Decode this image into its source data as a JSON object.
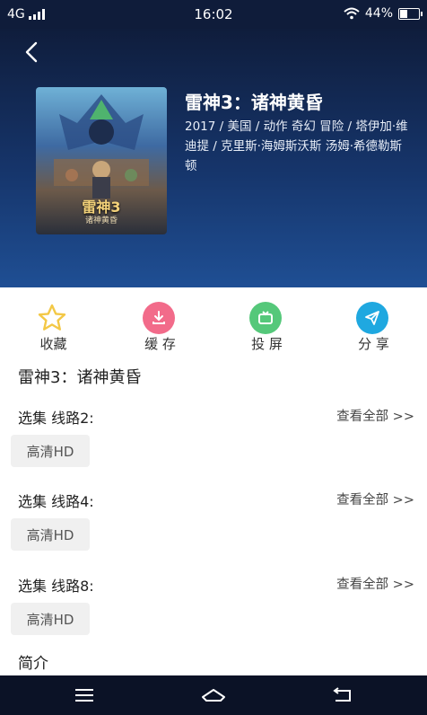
{
  "status": {
    "network": "4G",
    "time": "16:02",
    "battery_text": "44%",
    "battery_level": 0.44
  },
  "movie": {
    "title": "雷神3：诸神黄昏",
    "meta": "2017 / 美国 / 动作 奇幻 冒险 / 塔伊加·维迪提 / 克里斯·海姆斯沃斯 汤姆·希德勒斯顿",
    "poster_title": "雷神3",
    "poster_subtitle": "诸神黄昏"
  },
  "actions": [
    {
      "label": "收藏",
      "icon": "star-icon",
      "color": "#f3c846"
    },
    {
      "label": "缓 存",
      "icon": "download-icon",
      "color": "#f26b8a"
    },
    {
      "label": "投 屏",
      "icon": "tv-icon",
      "color": "#55c87a"
    },
    {
      "label": "分 享",
      "icon": "send-icon",
      "color": "#1fa8e0"
    }
  ],
  "content": {
    "section_title": "雷神3：诸神黄昏",
    "routes": [
      {
        "label": "选集 线路2:",
        "view_all": "查看全部 >>",
        "chip": "高清HD"
      },
      {
        "label": "选集 线路4:",
        "view_all": "查看全部 >>",
        "chip": "高清HD"
      },
      {
        "label": "选集 线路8:",
        "view_all": "查看全部 >>",
        "chip": "高清HD"
      }
    ],
    "intro_label": "简介"
  },
  "nav": {
    "icons": [
      "menu-icon",
      "home-icon",
      "back-icon"
    ]
  }
}
